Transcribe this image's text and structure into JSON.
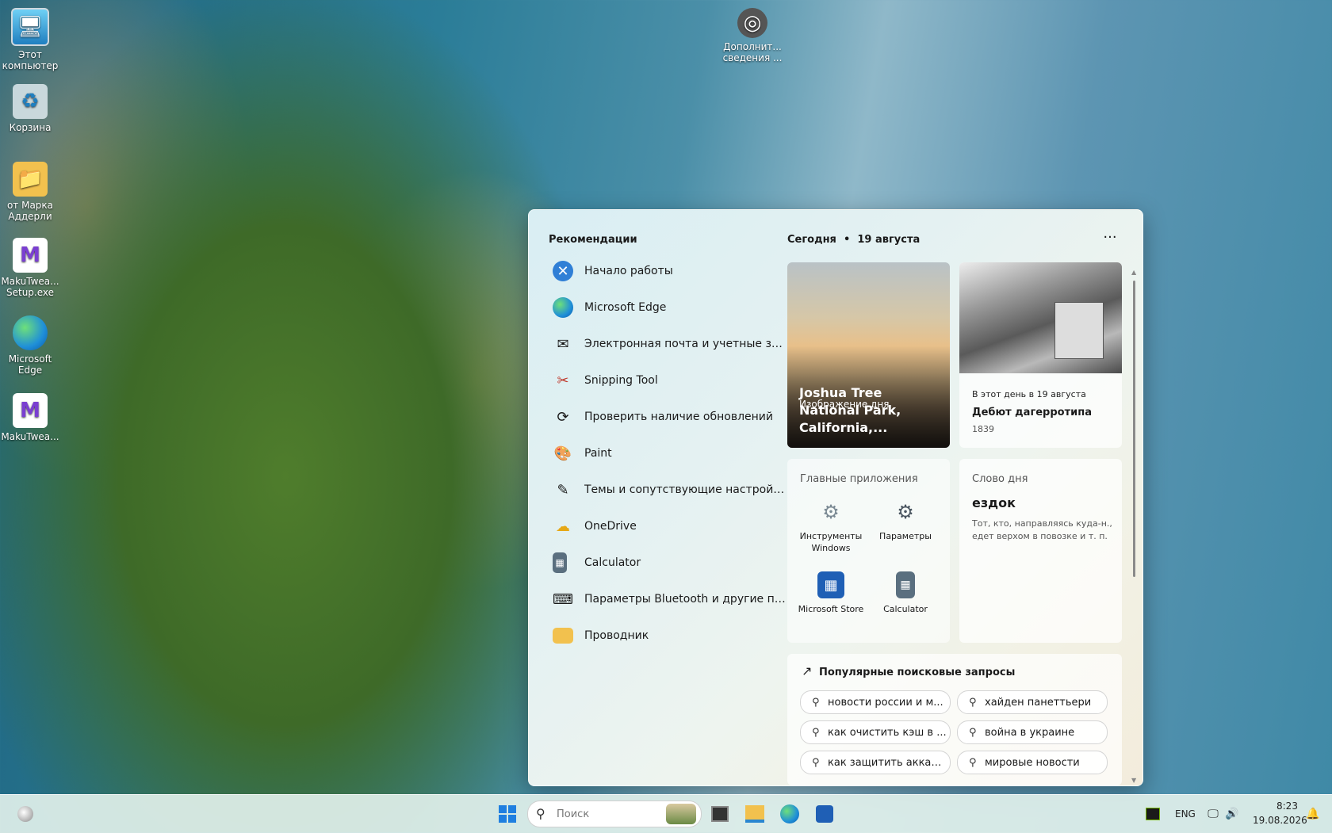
{
  "desktop": {
    "icons": [
      {
        "label": "Этот компьютер"
      },
      {
        "label": "Корзина"
      },
      {
        "label": "от Марка Аддерли"
      },
      {
        "label": "MakuTwea... Setup.exe"
      },
      {
        "label": "Microsoft Edge"
      },
      {
        "label": "MakuTwea..."
      },
      {
        "label": "Дополнит... сведения ..."
      }
    ]
  },
  "panel": {
    "recommendations_title": "Рекомендации",
    "recommendations": [
      {
        "label": "Начало работы",
        "icon": "get-started-icon"
      },
      {
        "label": "Microsoft Edge",
        "icon": "edge-icon"
      },
      {
        "label": "Электронная почта и учетные записи",
        "icon": "mail-icon"
      },
      {
        "label": "Snipping Tool",
        "icon": "scissors-icon"
      },
      {
        "label": "Проверить наличие обновлений",
        "icon": "refresh-icon"
      },
      {
        "label": "Paint",
        "icon": "palette-icon"
      },
      {
        "label": "Темы и сопутствующие настройки",
        "icon": "brush-icon"
      },
      {
        "label": "OneDrive",
        "icon": "onedrive-icon"
      },
      {
        "label": "Calculator",
        "icon": "calculator-icon"
      },
      {
        "label": "Параметры Bluetooth и другие пара...",
        "icon": "bluetooth-devices-icon"
      },
      {
        "label": "Проводник",
        "icon": "folder-icon"
      }
    ],
    "today_label": "Сегодня",
    "today_date": "19 августа",
    "more_label": "···",
    "image_of_day": {
      "caption": "Изображение дня",
      "title": "Joshua Tree National Park, California,..."
    },
    "on_this_day": {
      "subtitle": "В этот день в 19 августа",
      "title": "Дебют дагерротипа",
      "year": "1839"
    },
    "top_apps": {
      "heading": "Главные приложения",
      "apps": [
        {
          "label": "Инструменты Windows",
          "icon": "windows-tools-icon"
        },
        {
          "label": "Параметры",
          "icon": "settings-icon"
        },
        {
          "label": "Microsoft Store",
          "icon": "store-icon"
        },
        {
          "label": "Calculator",
          "icon": "calculator-icon"
        }
      ]
    },
    "word_of_day": {
      "heading": "Слово дня",
      "word": "ездок",
      "definition": "Тот, кто, направляясь куда-н., едет верхом в повозке и т. п."
    },
    "trending": {
      "heading": "Популярные поисковые запросы",
      "items": [
        "новости россии и м...",
        "хайден панеттьери",
        "как очистить кэш в ...",
        "война в украине",
        "как защитить аккаун...",
        "мировые новости"
      ]
    }
  },
  "taskbar": {
    "search_placeholder": "Поиск",
    "language": "ENG",
    "time": "8:23",
    "date": "19.08.2026"
  }
}
